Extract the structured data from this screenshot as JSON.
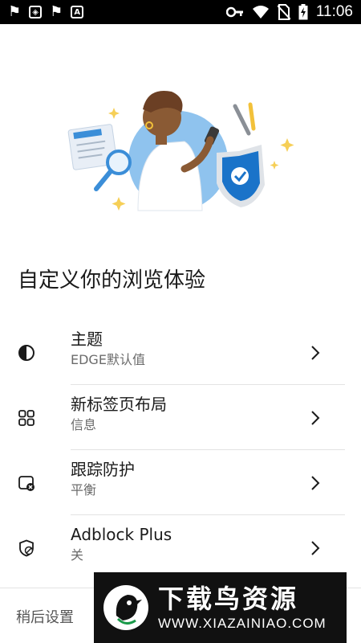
{
  "status_bar": {
    "left_icons": [
      "app-notification-icon",
      "shield-notification-icon",
      "app-notification-icon",
      "store-notification-icon"
    ],
    "right_icons": [
      "vpn-key-icon",
      "wifi-icon",
      "no-sim-icon",
      "battery-charging-icon"
    ],
    "time": "11:06"
  },
  "onboarding": {
    "heading": "自定义你的浏览体验",
    "items": [
      {
        "title": "主题",
        "subtitle": "EDGE默认值",
        "icon": "theme-contrast-icon"
      },
      {
        "title": "新标签页布局",
        "subtitle": "信息",
        "icon": "grid-layout-icon"
      },
      {
        "title": "跟踪防护",
        "subtitle": "平衡",
        "icon": "tracking-prevention-icon"
      },
      {
        "title": "Adblock Plus",
        "subtitle": "关",
        "icon": "adblock-shield-icon"
      }
    ],
    "later_label": "稍后设置"
  },
  "watermark": {
    "name": "下载鸟资源",
    "url": "WWW.XIAZAINIAO.COM"
  },
  "colors": {
    "background": "#ffffff",
    "status_bar": "#000000",
    "primary_text": "#1a1a1a",
    "secondary_text": "#6b6b6b",
    "divider": "#e3e3e3",
    "illustration_blue": "#8fc3ee",
    "shield_blue": "#1a73c9"
  }
}
